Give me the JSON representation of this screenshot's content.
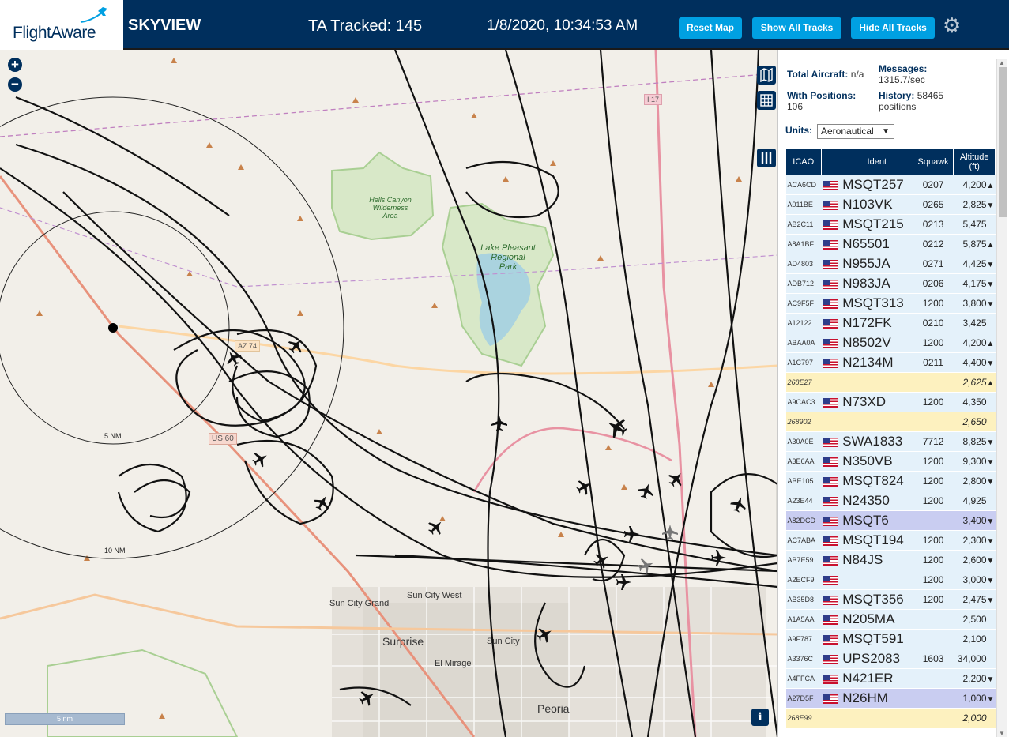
{
  "header": {
    "logo_text": "FlightAware",
    "app_name": "SKYVIEW",
    "tracked": "TA Tracked: 145",
    "datetime": "1/8/2020, 10:34:53 AM",
    "reset_label": "Reset Map",
    "show_label": "Show All Tracks",
    "hide_label": "Hide All Tracks",
    "settings_icon": "gear-icon",
    "brand_color": "#002f5d",
    "button_color": "#00a0e2"
  },
  "map": {
    "zoom_in": "+",
    "zoom_out": "−",
    "scale_label": "5 nm",
    "info_label": "i",
    "range_rings": [
      "5 NM",
      "10 NM"
    ],
    "places": [
      "Hells Canyon\nWilderness\nArea",
      "Lake Pleasant\nRegional\nPark",
      "Sun City West",
      "Sun City Grand",
      "Surprise",
      "Sun City",
      "El Mirage",
      "Peoria"
    ],
    "shields": [
      "US 60",
      "AZ 74",
      "I 17"
    ]
  },
  "sidebar": {
    "total_label": "Total Aircraft:",
    "total_value": "n/a",
    "messages_label": "Messages:",
    "messages_value": "1315.7/sec",
    "positions_label": "With Positions:",
    "positions_value": "106",
    "history_label": "History:",
    "history_value": "58465 positions",
    "units_label": "Units:",
    "units_value": "Aeronautical",
    "columns": [
      "ICAO",
      "",
      "Ident",
      "Squawk",
      "Altitude (ft)"
    ],
    "rows": [
      {
        "icao": "ACA6CD",
        "ident": "MSQT257",
        "squawk": "0207",
        "alt": "4,200",
        "trend": "▲",
        "flag": true,
        "state": ""
      },
      {
        "icao": "A011BE",
        "ident": "N103VK",
        "squawk": "0265",
        "alt": "2,825",
        "trend": "▼",
        "flag": true,
        "state": ""
      },
      {
        "icao": "AB2C11",
        "ident": "MSQT215",
        "squawk": "0213",
        "alt": "5,475",
        "trend": "",
        "flag": true,
        "state": ""
      },
      {
        "icao": "A8A1BF",
        "ident": "N65501",
        "squawk": "0212",
        "alt": "5,875",
        "trend": "▲",
        "flag": true,
        "state": ""
      },
      {
        "icao": "AD4803",
        "ident": "N955JA",
        "squawk": "0271",
        "alt": "4,425",
        "trend": "▼",
        "flag": true,
        "state": ""
      },
      {
        "icao": "ADB712",
        "ident": "N983JA",
        "squawk": "0206",
        "alt": "4,175",
        "trend": "▼",
        "flag": true,
        "state": ""
      },
      {
        "icao": "AC9F5F",
        "ident": "MSQT313",
        "squawk": "1200",
        "alt": "3,800",
        "trend": "▼",
        "flag": true,
        "state": ""
      },
      {
        "icao": "A12122",
        "ident": "N172FK",
        "squawk": "0210",
        "alt": "3,425",
        "trend": "",
        "flag": true,
        "state": ""
      },
      {
        "icao": "ABAA0A",
        "ident": "N8502V",
        "squawk": "1200",
        "alt": "4,200",
        "trend": "▲",
        "flag": true,
        "state": ""
      },
      {
        "icao": "A1C797",
        "ident": "N2134M",
        "squawk": "0211",
        "alt": "4,400",
        "trend": "▼",
        "flag": true,
        "state": ""
      },
      {
        "icao": "268E27",
        "ident": "",
        "squawk": "",
        "alt": "2,625",
        "trend": "▲",
        "flag": false,
        "state": "nopos"
      },
      {
        "icao": "A9CAC3",
        "ident": "N73XD",
        "squawk": "1200",
        "alt": "4,350",
        "trend": "",
        "flag": true,
        "state": ""
      },
      {
        "icao": "268902",
        "ident": "",
        "squawk": "",
        "alt": "2,650",
        "trend": "",
        "flag": false,
        "state": "nopos"
      },
      {
        "icao": "A30A0E",
        "ident": "SWA1833",
        "squawk": "7712",
        "alt": "8,825",
        "trend": "▼",
        "flag": true,
        "state": ""
      },
      {
        "icao": "A3E6AA",
        "ident": "N350VB",
        "squawk": "1200",
        "alt": "9,300",
        "trend": "▼",
        "flag": true,
        "state": ""
      },
      {
        "icao": "ABE105",
        "ident": "MSQT824",
        "squawk": "1200",
        "alt": "2,800",
        "trend": "▼",
        "flag": true,
        "state": ""
      },
      {
        "icao": "A23E44",
        "ident": "N24350",
        "squawk": "1200",
        "alt": "4,925",
        "trend": "",
        "flag": true,
        "state": ""
      },
      {
        "icao": "A82DCD",
        "ident": "MSQT6",
        "squawk": "",
        "alt": "3,400",
        "trend": "▼",
        "flag": true,
        "state": "sel"
      },
      {
        "icao": "AC7ABA",
        "ident": "MSQT194",
        "squawk": "1200",
        "alt": "2,300",
        "trend": "▼",
        "flag": true,
        "state": ""
      },
      {
        "icao": "AB7E59",
        "ident": "N84JS",
        "squawk": "1200",
        "alt": "2,600",
        "trend": "▼",
        "flag": true,
        "state": ""
      },
      {
        "icao": "A2ECF9",
        "ident": "",
        "squawk": "1200",
        "alt": "3,000",
        "trend": "▼",
        "flag": true,
        "state": ""
      },
      {
        "icao": "AB35D8",
        "ident": "MSQT356",
        "squawk": "1200",
        "alt": "2,475",
        "trend": "▼",
        "flag": true,
        "state": ""
      },
      {
        "icao": "A1A5AA",
        "ident": "N205MA",
        "squawk": "",
        "alt": "2,500",
        "trend": "",
        "flag": true,
        "state": ""
      },
      {
        "icao": "A9F787",
        "ident": "MSQT591",
        "squawk": "",
        "alt": "2,100",
        "trend": "",
        "flag": true,
        "state": ""
      },
      {
        "icao": "A3376C",
        "ident": "UPS2083",
        "squawk": "1603",
        "alt": "34,000",
        "trend": "",
        "flag": true,
        "state": ""
      },
      {
        "icao": "A4FFCA",
        "ident": "N421ER",
        "squawk": "",
        "alt": "2,200",
        "trend": "▼",
        "flag": true,
        "state": ""
      },
      {
        "icao": "A27D5F",
        "ident": "N26HM",
        "squawk": "",
        "alt": "1,000",
        "trend": "▼",
        "flag": true,
        "state": "sel"
      },
      {
        "icao": "268E99",
        "ident": "",
        "squawk": "",
        "alt": "2,000",
        "trend": "",
        "flag": false,
        "state": "nopos"
      }
    ]
  }
}
